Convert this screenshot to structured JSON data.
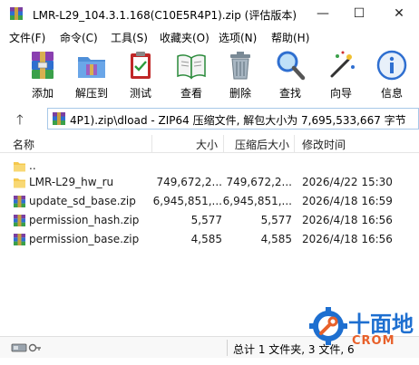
{
  "window": {
    "title": "LMR-L29_104.3.1.168(C10E5R4P1).zip (评估版本)",
    "controls": {
      "minimize": "—",
      "maximize": "☐",
      "close": "✕"
    }
  },
  "menu": [
    {
      "label": "文件(F)"
    },
    {
      "label": "命令(C)"
    },
    {
      "label": "工具(S)"
    },
    {
      "label": "收藏夹(O)"
    },
    {
      "label": "选项(N)"
    },
    {
      "label": "帮助(H)"
    }
  ],
  "toolbar": [
    {
      "label": "添加",
      "icon": "add-archive-icon"
    },
    {
      "label": "解压到",
      "icon": "extract-folder-icon"
    },
    {
      "label": "测试",
      "icon": "test-clipboard-icon"
    },
    {
      "label": "查看",
      "icon": "view-book-icon"
    },
    {
      "label": "删除",
      "icon": "delete-trash-icon"
    },
    {
      "label": "查找",
      "icon": "find-magnifier-icon"
    },
    {
      "label": "向导",
      "icon": "wizard-wand-icon"
    },
    {
      "label": "信息",
      "icon": "info-icon"
    }
  ],
  "pathbar": {
    "up_label": "🡑",
    "path": "4P1).zip\\dload - ZIP64 压缩文件, 解包大小为 7,695,533,667 字节"
  },
  "columns": {
    "name": "名称",
    "size": "大小",
    "packed": "压缩后大小",
    "modified": "修改时间"
  },
  "files": [
    {
      "name": "..",
      "size": "",
      "packed": "",
      "modified": "",
      "kind": "parent"
    },
    {
      "name": "LMR-L29_hw_ru",
      "size": "749,672,2...",
      "packed": "749,672,2...",
      "modified": "2026/4/22 15:30",
      "kind": "folder"
    },
    {
      "name": "update_sd_base.zip",
      "size": "6,945,851,...",
      "packed": "6,945,851,...",
      "modified": "2026/4/18 16:59",
      "kind": "zip"
    },
    {
      "name": "permission_hash.zip",
      "size": "5,577",
      "packed": "5,577",
      "modified": "2026/4/18 16:56",
      "kind": "zip"
    },
    {
      "name": "permission_base.zip",
      "size": "4,585",
      "packed": "4,585",
      "modified": "2026/4/18 16:56",
      "kind": "zip"
    }
  ],
  "status": {
    "text": "总计 1 文件夹, 3 文件, 6"
  },
  "watermark": {
    "text": "十面地",
    "sub": "CROM"
  },
  "colors": {
    "accent_blue": "#1e6fd0",
    "folder_yellow": "#f5c84c",
    "winrar_purple": "#7b3fa0",
    "watermark_orange": "#e8602a"
  }
}
